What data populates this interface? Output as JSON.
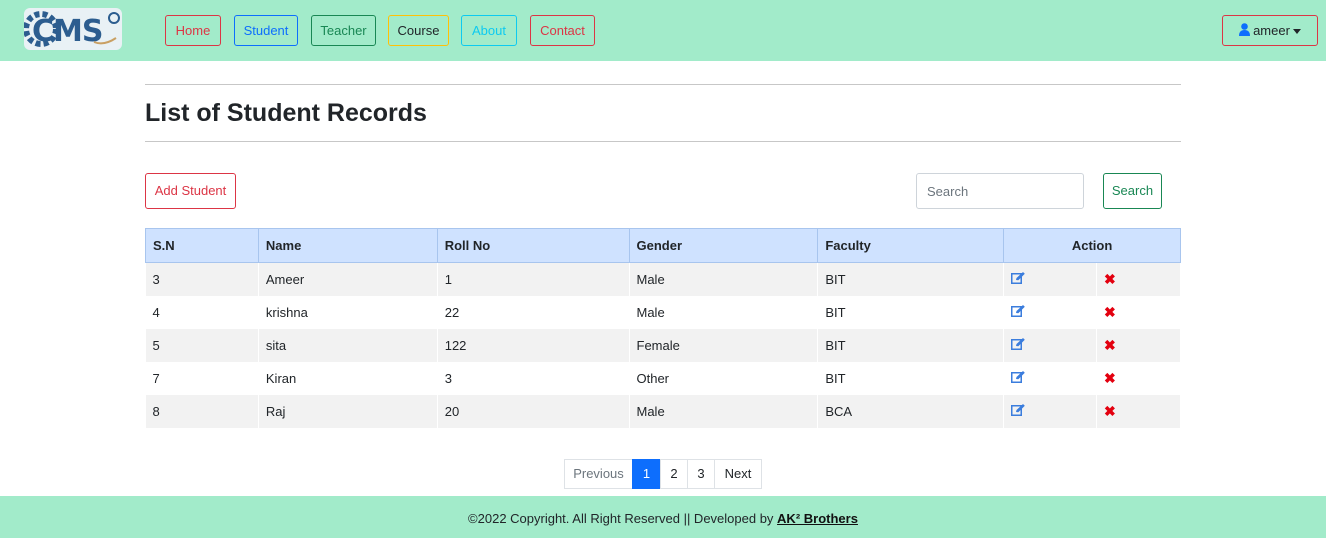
{
  "navbar": {
    "logo_text": "CMS",
    "links": [
      {
        "label": "Home",
        "color": "#dc3545"
      },
      {
        "label": "Student",
        "color": "#0d6efd"
      },
      {
        "label": "Teacher",
        "color": "#198754"
      },
      {
        "label": "Course",
        "color": "#212529"
      },
      {
        "label": "About",
        "color": "#0dcaf0"
      },
      {
        "label": "Contact",
        "color": "#dc3545"
      }
    ],
    "user": {
      "name": "ameer",
      "icon": "user-icon"
    }
  },
  "page": {
    "title": "List of Student Records",
    "add_button": "Add Student",
    "search": {
      "placeholder": "Search",
      "value": "",
      "button": "Search"
    }
  },
  "table": {
    "headers": [
      "S.N",
      "Name",
      "Roll No",
      "Gender",
      "Faculty",
      "Action"
    ],
    "rows": [
      {
        "sn": "3",
        "name": "Ameer",
        "roll": "1",
        "gender": "Male",
        "faculty": "BIT"
      },
      {
        "sn": "4",
        "name": "krishna",
        "roll": "22",
        "gender": "Male",
        "faculty": "BIT"
      },
      {
        "sn": "5",
        "name": "sita",
        "roll": "122",
        "gender": "Female",
        "faculty": "BIT"
      },
      {
        "sn": "7",
        "name": "Kiran",
        "roll": "3",
        "gender": "Other",
        "faculty": "BIT"
      },
      {
        "sn": "8",
        "name": "Raj",
        "roll": "20",
        "gender": "Male",
        "faculty": "BCA"
      }
    ],
    "row_actions": {
      "edit_icon": "edit-icon",
      "delete_icon": "delete-icon",
      "delete_glyph": "✖"
    }
  },
  "pagination": {
    "previous": "Previous",
    "pages": [
      "1",
      "2",
      "3"
    ],
    "active_page": "1",
    "next": "Next"
  },
  "footer": {
    "text": "©2022 Copyright. All Right Reserved || Developed by ",
    "brand": "AK² Brothers"
  },
  "colors": {
    "navbar_bg": "#a2ebca",
    "table_header_bg": "#cfe2ff",
    "active_page": "#0d6efd",
    "delete": "#e3000f"
  }
}
